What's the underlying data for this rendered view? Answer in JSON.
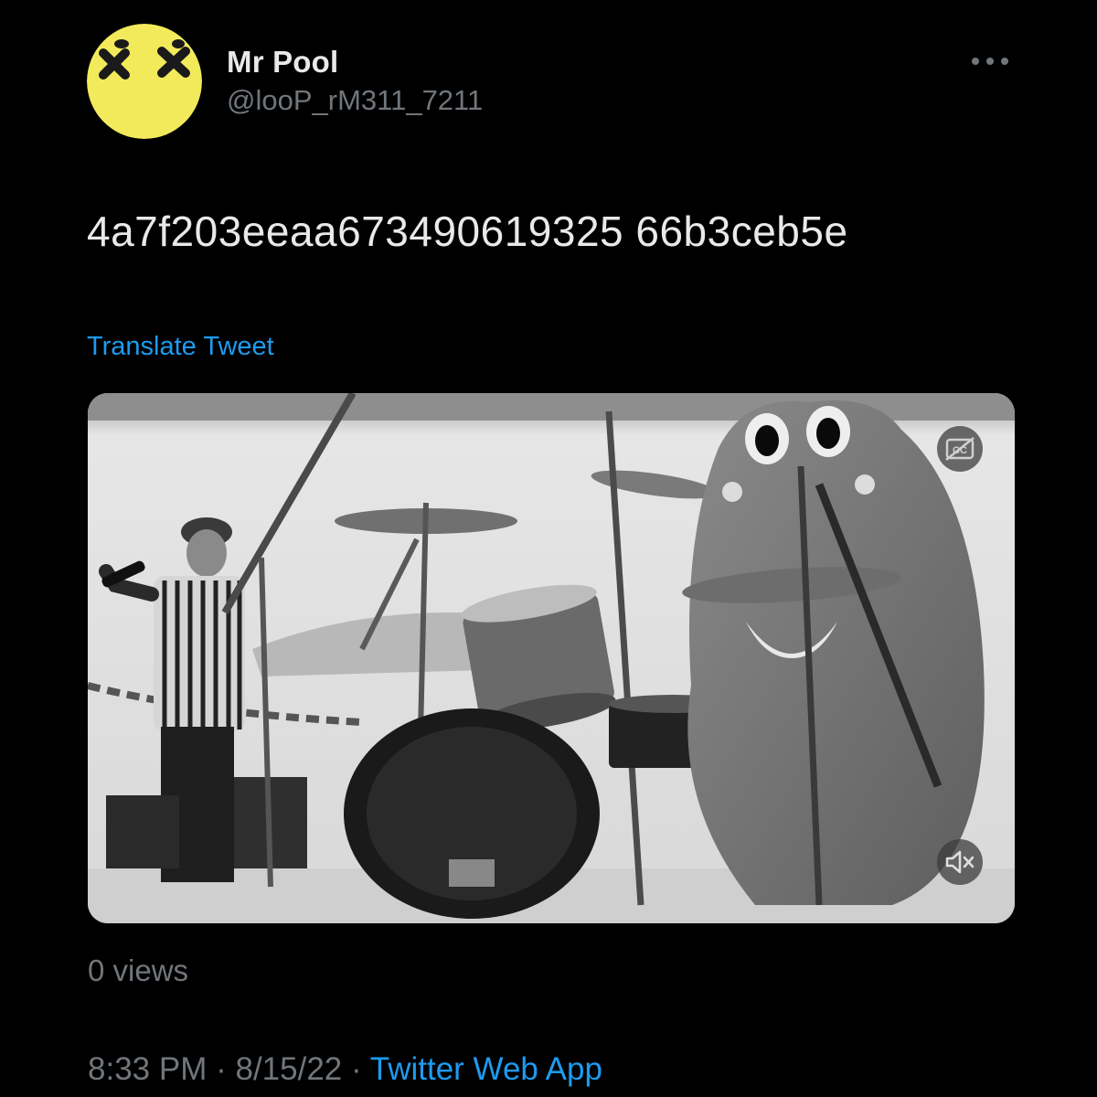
{
  "author": {
    "display_name": "Mr Pool",
    "handle": "@looP_rM311_7211",
    "avatar_icon": "yellow-dead-face-avatar"
  },
  "tweet": {
    "text": "4a7f203eeaa673490619325 66b3ceb5e",
    "translate_label": "Translate Tweet"
  },
  "media": {
    "type": "video",
    "cc_icon": "closed-captions-off-icon",
    "mute_icon": "muted-speaker-icon"
  },
  "stats": {
    "views": "0 views"
  },
  "meta": {
    "time": "8:33 PM",
    "separator": "·",
    "date": "8/15/22",
    "source": "Twitter Web App"
  },
  "colors": {
    "background": "#000000",
    "text_primary": "#e7e9ea",
    "text_secondary": "#71767b",
    "link": "#1d9bf0",
    "avatar_yellow": "#f2ea5a"
  }
}
